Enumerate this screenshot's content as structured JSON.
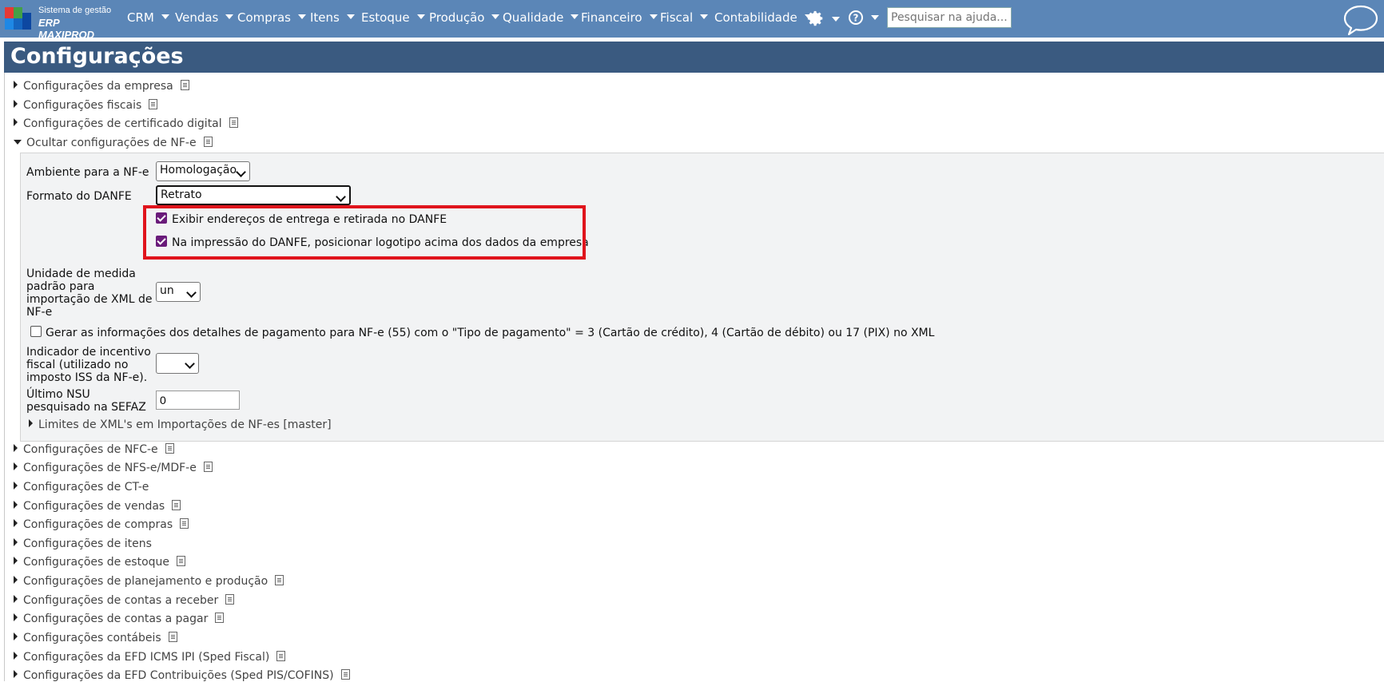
{
  "app": {
    "logo_line1": "Sistema de gestão",
    "logo_line2": "ERP MAXIPROD",
    "logo_colors": [
      "#e53935",
      "#43a047",
      "#1e88e5",
      "#1565c0"
    ]
  },
  "nav": {
    "items": [
      "CRM",
      "Vendas",
      "Compras",
      "Itens",
      "Estoque",
      "Produção",
      "Qualidade",
      "Financeiro",
      "Fiscal",
      "Contabilidade"
    ],
    "settings_icon": "gear-icon",
    "help_icon": "question-circle-icon",
    "search_placeholder": "Pesquisar na ajuda...",
    "chat_icon": "speech-bubble-icon"
  },
  "page": {
    "title": "Configurações"
  },
  "sections_top": [
    "Configurações da empresa",
    "Configurações fiscais",
    "Configurações de certificado digital"
  ],
  "nfe": {
    "header": "Ocultar configurações de NF-e",
    "ambiente_label": "Ambiente para a NF-e",
    "ambiente_value": "Homologação",
    "formato_label": "Formato do DANFE",
    "formato_value": "Retrato",
    "check1_label": "Exibir endereços de entrega e retirada no DANFE",
    "check1_checked": true,
    "check2_label": "Na impressão do DANFE, posicionar logotipo acima dos dados da empresa",
    "check2_checked": true,
    "unidade_label_lines": [
      "Unidade de medida",
      "padrão para",
      "importação de XML de",
      "NF-e"
    ],
    "unidade_value": "un",
    "pagamento_label": "Gerar as informações dos detalhes de pagamento para NF-e (55) com o \"Tipo de pagamento\" = 3 (Cartão de crédito), 4 (Cartão de débito) ou 17 (PIX) no XML",
    "pagamento_checked": false,
    "incentivo_label_lines": [
      "Indicador de incentivo",
      "fiscal (utilizado no",
      "imposto ISS da NF-e)."
    ],
    "incentivo_value": "",
    "nsu_label_lines": [
      "Último NSU",
      "pesquisado na SEFAZ"
    ],
    "nsu_value": "0",
    "limites_label": "Limites de XML's em Importações de NF-es [master]"
  },
  "sections_bottom": [
    {
      "label": "Configurações de NFC-e",
      "doc": true
    },
    {
      "label": "Configurações de NFS-e/MDF-e",
      "doc": true
    },
    {
      "label": "Configurações de CT-e",
      "doc": false
    },
    {
      "label": "Configurações de vendas",
      "doc": true
    },
    {
      "label": "Configurações de compras",
      "doc": true
    },
    {
      "label": "Configurações de itens",
      "doc": false
    },
    {
      "label": "Configurações de estoque",
      "doc": true
    },
    {
      "label": "Configurações de planejamento e produção",
      "doc": true
    },
    {
      "label": "Configurações de contas a receber",
      "doc": true
    },
    {
      "label": "Configurações de contas a pagar",
      "doc": true
    },
    {
      "label": "Configurações contábeis",
      "doc": true
    },
    {
      "label": "Configurações da EFD ICMS IPI (Sped Fiscal)",
      "doc": true
    },
    {
      "label": "Configurações da EFD Contribuições (Sped PIS/COFINS)",
      "doc": true
    }
  ],
  "colors": {
    "topbar": "#5b86b7",
    "titlebar": "#3a5a80",
    "highlight": "#e0141c",
    "checkbox": "#6a1b7a"
  }
}
